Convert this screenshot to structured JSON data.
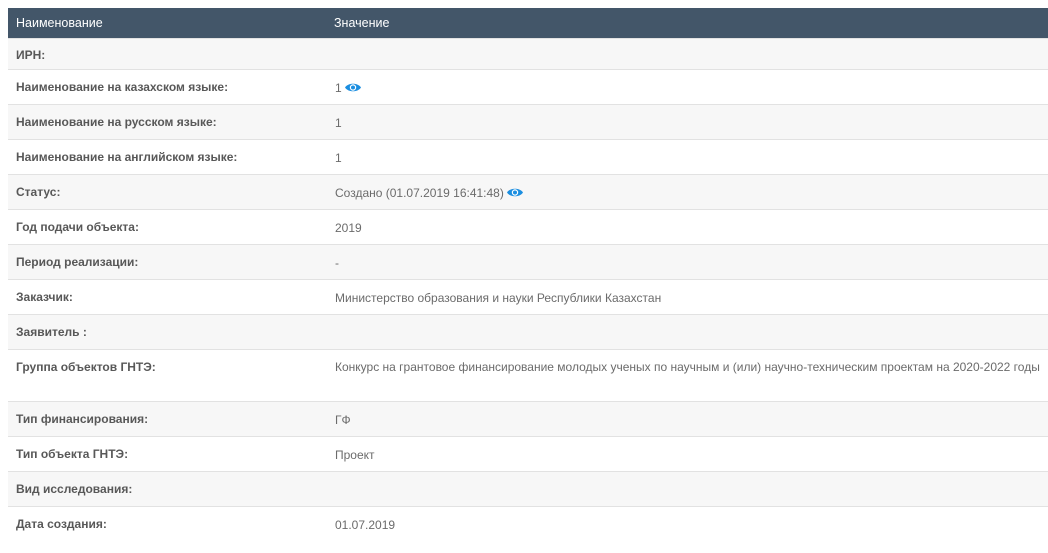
{
  "header": {
    "col_name": "Наименование",
    "col_value": "Значение"
  },
  "rows": [
    {
      "label": "ИРН:",
      "value": ""
    },
    {
      "label": "Наименование на казахском языке:",
      "value": "1",
      "icon": "eye-icon"
    },
    {
      "label": "Наименование на русском языке:",
      "value": "1"
    },
    {
      "label": "Наименование на английском языке:",
      "value": "1"
    },
    {
      "label": "Статус:",
      "value": "Создано (01.07.2019 16:41:48)",
      "icon": "eye-icon"
    },
    {
      "label": "Год подачи объекта:",
      "value": "2019"
    },
    {
      "label": "Период реализации:",
      "value": "-"
    },
    {
      "label": "Заказчик:",
      "value": "Министерство образования и науки Республики Казахстан"
    },
    {
      "label": "Заявитель :",
      "value": ""
    },
    {
      "label": "Группа объектов ГНТЭ:",
      "value": "Конкурс на грантовое финансирование молодых ученых по научным и (или) научно-техническим проектам на 2020-2022 годы"
    },
    {
      "label": "Тип финансирования:",
      "value": "ГФ"
    },
    {
      "label": "Тип объекта ГНТЭ:",
      "value": "Проект"
    },
    {
      "label": "Вид исследования:",
      "value": ""
    },
    {
      "label": "Дата создания:",
      "value": "01.07.2019"
    }
  ],
  "colors": {
    "header_bg": "#435669",
    "header_text": "#ffffff",
    "row_odd": "#f7f7f7",
    "row_even": "#ffffff",
    "eye_icon": "#1b8ee0"
  }
}
